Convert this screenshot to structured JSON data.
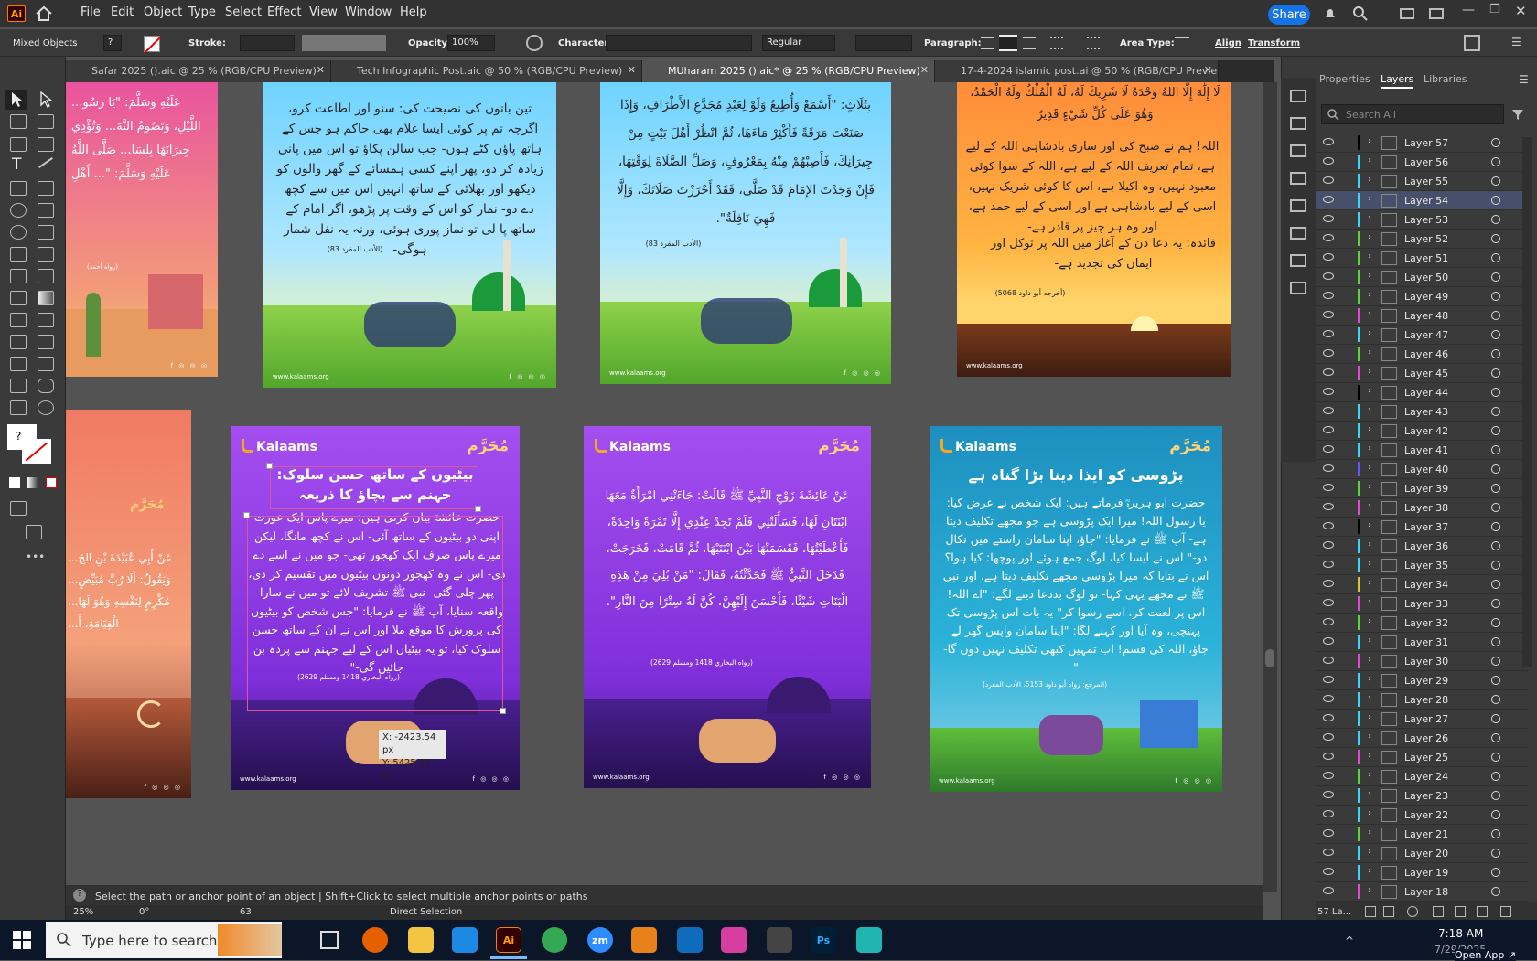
{
  "app": {
    "logo": "Ai",
    "menus": [
      "File",
      "Edit",
      "Object",
      "Type",
      "Select",
      "Effect",
      "View",
      "Window",
      "Help"
    ],
    "share": "Share"
  },
  "control": {
    "selection": "Mixed Objects",
    "stroke_label": "Stroke:",
    "opacity_label": "Opacity:",
    "opacity_value": "100%",
    "character_label": "Character:",
    "font_style": "Regular",
    "paragraph_label": "Paragraph:",
    "area_type_label": "Area Type:",
    "align": "Align",
    "transform": "Transform",
    "style_q": "?"
  },
  "tabs": [
    {
      "label": "Safar 2025 ().aic @ 25 % (RGB/CPU Preview)"
    },
    {
      "label": "Tech Infographic Post.aic @ 50 % (RGB/CPU Preview)"
    },
    {
      "label": "MUharam 2025 ().aic* @ 25 % (RGB/CPU Preview)"
    },
    {
      "label": "17-4-2024 islamic post.ai @ 50 % (RGB/CPU Preview)"
    }
  ],
  "panel": {
    "tabs": [
      "Properties",
      "Layers",
      "Libraries"
    ],
    "search_placeholder": "Search All",
    "count": "57 La..."
  },
  "layers": [
    {
      "name": "Layer 57",
      "color": "#000000"
    },
    {
      "name": "Layer 56",
      "color": "#3ad4ff"
    },
    {
      "name": "Layer 55",
      "color": "#3ad4ff"
    },
    {
      "name": "Layer 54",
      "color": "#3ad4ff"
    },
    {
      "name": "Layer 53",
      "color": "#3ad4ff"
    },
    {
      "name": "Layer 52",
      "color": "#5ad63a"
    },
    {
      "name": "Layer 51",
      "color": "#5ad63a"
    },
    {
      "name": "Layer 50",
      "color": "#5ad63a"
    },
    {
      "name": "Layer 49",
      "color": "#5ad63a"
    },
    {
      "name": "Layer 48",
      "color": "#e04ad6"
    },
    {
      "name": "Layer 47",
      "color": "#3ad4ff"
    },
    {
      "name": "Layer 46",
      "color": "#5ad63a"
    },
    {
      "name": "Layer 45",
      "color": "#e04ad6"
    },
    {
      "name": "Layer 44",
      "color": "#000000"
    },
    {
      "name": "Layer 43",
      "color": "#3ad4ff"
    },
    {
      "name": "Layer 42",
      "color": "#3ad4ff"
    },
    {
      "name": "Layer 41",
      "color": "#3ad4ff"
    },
    {
      "name": "Layer 40",
      "color": "#5a5aff"
    },
    {
      "name": "Layer 39",
      "color": "#5ad63a"
    },
    {
      "name": "Layer 38",
      "color": "#e04ad6"
    },
    {
      "name": "Layer 37",
      "color": "#000000"
    },
    {
      "name": "Layer 36",
      "color": "#3ad4ff"
    },
    {
      "name": "Layer 35",
      "color": "#3ad4ff"
    },
    {
      "name": "Layer 34",
      "color": "#e0c23a"
    },
    {
      "name": "Layer 33",
      "color": "#e04ad6"
    },
    {
      "name": "Layer 32",
      "color": "#5ad63a"
    },
    {
      "name": "Layer 31",
      "color": "#3ad4ff"
    },
    {
      "name": "Layer 30",
      "color": "#e04ad6"
    },
    {
      "name": "Layer 29",
      "color": "#3ad4ff"
    },
    {
      "name": "Layer 28",
      "color": "#3ad4ff"
    },
    {
      "name": "Layer 27",
      "color": "#3ad4ff"
    },
    {
      "name": "Layer 26",
      "color": "#3ad4ff"
    },
    {
      "name": "Layer 25",
      "color": "#e04ad6"
    },
    {
      "name": "Layer 24",
      "color": "#5ad63a"
    },
    {
      "name": "Layer 23",
      "color": "#3ad4ff"
    },
    {
      "name": "Layer 22",
      "color": "#3ad4ff"
    },
    {
      "name": "Layer 21",
      "color": "#5ad63a"
    },
    {
      "name": "Layer 20",
      "color": "#3ad4ff"
    },
    {
      "name": "Layer 19",
      "color": "#3ad4ff"
    },
    {
      "name": "Layer 18",
      "color": "#e04ad6"
    }
  ],
  "selected_layer": "Layer 54",
  "canvas": {
    "a1": {
      "hadith": "تین باتوں کی نصیحت کی: سنو اور اطاعت کرو، اگرچہ تم پر کوئی ایسا غلام بھی حاکم ہو جس کے ہاتھ پاؤں کٹے ہوں- جب سالن پکاؤ تو اس میں پانی زیادہ کر دو، پھر اپنے کسی ہمسائے کے گھر والوں کو دیکھو اور بھلائی کے ساتھ انہیں اس میں سے کچھ دے دو- نماز کو اس کے وقت پر پڑھو، اگر امام کے ساتھ پا لی تو نماز پوری ہوئی، ورنہ یہ نفل شمار ہوگی-",
      "ref": "(الأدب المفرد 83)",
      "url": "www.kalaams.org",
      "soc": "f ◎ ◎ ◎"
    },
    "a2": {
      "arabic": "بِثَلَاثٍ: \"أَسْمَعْ وَأُطِيعُ وَلَوْ لِعَبْدٍ مُجَدَّعِ الأَطْرَافِ، وَإِذَا صَنَعْتَ مَرَقَةً فَأَكْثِرْ مَاءَهَا، ثُمَّ انْظُرْ أَهْلَ بَيْتٍ مِنْ جِيرَانِكَ، فَأَصِبْهُمْ مِنْهُ بِمَعْرُوفٍ، وَصَلِّ الصَّلَاةَ لِوَقْتِهَا، فَإِنْ وَجَدْتَ الإِمَامَ قَدْ صَلَّى، فَقَدْ أَحْرَزْتَ صَلَاتَكَ، وَإِلَّا فَهِيَ نَافِلَةٌ\".",
      "ref": "(الأدب المفرد 83)",
      "url": "www.kalaams.org",
      "soc": "f ◎ ◎ ◎"
    },
    "a3": {
      "top": "لَا إِلَٰهَ إِلَّا اللهُ وَحْدَهُ لَا شَرِيكَ لَهُ، لَهُ الْمُلْكُ وَلَهُ الْحَمْدُ، وَهُوَ عَلَى كُلِّ شَيْءٍ قَدِيرٌ",
      "urdu": "اللہ! ہم نے صبح کی اور ساری بادشاہی اللہ کے لیے ہے، تمام تعریف اللہ کے لیے ہے، اللہ کے سوا کوئی معبود نہیں، وہ اکیلا ہے، اس کا کوئی شریک نہیں، اسی کے لیے بادشاہی ہے اور اسی کے لیے حمد ہے، اور وہ ہر چیز پر قادر ہے-",
      "benefit": "فائدہ: یہ دعا دن کے آغاز میں اللہ پر توکل اور ایمان کی تجدید ہے-",
      "ref": "(أخرجه أبو داود 5068)",
      "url": "www.kalaams.org"
    },
    "p1": {
      "brand": "Kalaams",
      "muharram": "مُحَرَّم",
      "title": "بیٹیوں کے ساتھ حسن سلوک: جہنم سے بچاؤ کا ذریعہ",
      "body": "حضرت عائشہؓ بیان کرتی ہیں: میرے پاس ایک عورت اپنی دو بیٹیوں کے ساتھ آئی- اس نے کچھ مانگا، لیکن میرے پاس صرف ایک کھجور تھی- جو میں نے اسے دے دی- اس نے وہ کھجور دونوں بیٹیوں میں تقسیم کر دی، پھر چلی گئی- نبی ﷺ تشریف لائے تو میں نے سارا واقعہ سنایا، آپ ﷺ نے فرمایا: \"جس شخص کو بیٹیوں کی پرورش کا موقع ملا اور اس نے ان کے ساتھ حسن سلوک کیا، تو یہ بیٹیاں اس کے لیے جہنم سے پردہ بن جائیں گی-\"",
      "ref": "(رواه البخاري 1418 ومسلم 2629)",
      "url": "www.kalaams.org",
      "soc": "f ◎ ◎ ◎"
    },
    "p2": {
      "brand": "Kalaams",
      "muharram": "مُحَرَّم",
      "arabic": "عَنْ عَائِشَةَ زَوْجِ النَّبِيِّ ﷺ قَالَتْ: جَاءَتْنِي امْرَأَةٌ مَعَهَا ابْنَتَانِ لَهَا، فَسَأَلَتْنِي فَلَمْ تَجِدْ عِنْدِي إِلَّا تَمْرَةً وَاحِدَةً، فَأَعْطَيْتُهَا، فَقَسَمَتْهَا بَيْنَ ابْنَتَيْهَا، ثُمَّ قَامَتْ، فَخَرَجَتْ، فَدَخَلَ النَّبِيُّ ﷺ فَحَدَّثْتُهُ، فَقَالَ: \"مَنْ بُلِيَ مِنْ هَذِهِ الْبَنَاتِ شَيْئًا، فَأَحْسَنَ إِلَيْهِنَّ، كُنَّ لَهُ سِتْرًا مِنَ النَّارِ\".",
      "ref": "(رواه البخاري 1418 ومسلم 2629)",
      "url": "www.kalaams.org",
      "soc": "f ◎ ◎ ◎"
    },
    "p3": {
      "brand": "Kalaams",
      "muharram": "مُحَرَّم",
      "title": "پڑوسی کو ایذا دینا بڑا گناہ ہے",
      "body": "حضرت ابو ہریرہؓ فرماتے ہیں: ایک شخص نے عرض کیا: یا رسول اللہ! میرا ایک پڑوسی ہے جو مجھے تکلیف دیتا ہے- آپ ﷺ نے فرمایا: \"جاؤ، اپنا سامان راستے میں نکال دو-\" اس نے ایسا کیا، لوگ جمع ہوئے اور پوچھا: کیا ہوا؟ اس نے بتایا کہ میرا پڑوسی مجھے تکلیف دیتا ہے، اور نبی ﷺ نے مجھے یہی کہا- تو لوگ بددعا دینے لگے: \"اے اللہ! اس پر لعنت کر، اسے رسوا کر\" یہ بات اس پڑوسی تک پہنچی، وہ آیا اور کہنے لگا: \"اپنا سامان واپس گھر لے جاؤ، اللہ کی قسم! اب تمہیں کبھی تکلیف نہیں دوں گا-\"",
      "ref": "(المرجع: رواه أبو داود 5153، الأدب المفرد)",
      "url": "www.kalaams.org",
      "soc": "f ◎ ◎ ◎"
    },
    "left_top": {
      "arabic": "عَلَيْهِ وَسَلَّمَ: \"يَا رَسُو... اللَّيْلِ، وَتَصُومُ النَّهَ... وَتُؤْذِي جِيرَانَهَا بِلِسَا... صَلَّى اللَّهُ عَلَيْهِ وَسَلَّمَ: \"... أَهْلِ",
      "ref": "(رواه أحمد)",
      "soc": "f ◎ ◎ ◎"
    },
    "left_bot": {
      "muharram": "مُحَرَّم",
      "arabic": "عَنْ أَبِي عُبَيْدَةَ بْنِ الجَ... وَيَقُولُ: أَلَا رُبَّ مُبَيِّضٍ... مُكْرِمٍ لِنَفْسِهِ وَهُوَ لَهَا... الْقِيَامَةِ، أَ...",
      "soc": "f ◎ ◎ ◎"
    }
  },
  "tooltip": {
    "x": "X: -2423.54 px",
    "y": "Y: 5425.55 px"
  },
  "status": {
    "hint": "Select the path or anchor point of an object  |  Shift+Click to select multiple anchor points or paths",
    "zoom": "25%",
    "angle": "0°",
    "artboard": "63",
    "tool": "Direct Selection"
  },
  "taskbar": {
    "search": "Type here to search",
    "time": "7:18 AM",
    "date": "7/29/2025",
    "open_app": "Open App ↗"
  }
}
